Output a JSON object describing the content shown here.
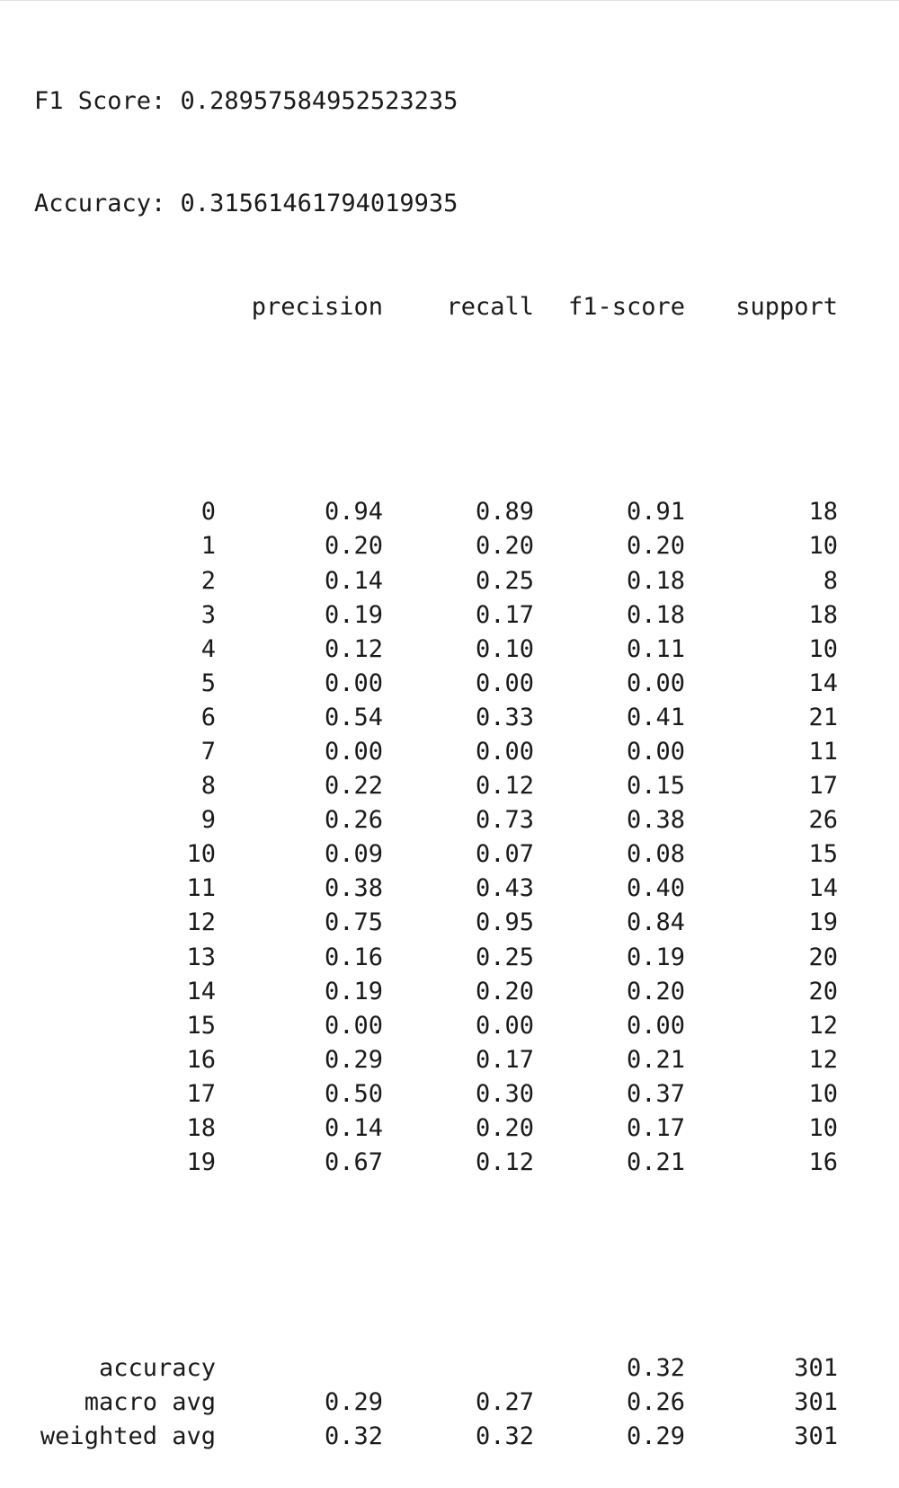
{
  "summary": {
    "f1_line": "F1 Score: 0.28957584952523235",
    "accuracy_line": "Accuracy: 0.31561461794019935"
  },
  "report": {
    "headers": [
      "",
      "precision",
      "recall",
      "f1-score",
      "support"
    ],
    "rows": [
      [
        "0",
        "0.94",
        "0.89",
        "0.91",
        "18"
      ],
      [
        "1",
        "0.20",
        "0.20",
        "0.20",
        "10"
      ],
      [
        "2",
        "0.14",
        "0.25",
        "0.18",
        "8"
      ],
      [
        "3",
        "0.19",
        "0.17",
        "0.18",
        "18"
      ],
      [
        "4",
        "0.12",
        "0.10",
        "0.11",
        "10"
      ],
      [
        "5",
        "0.00",
        "0.00",
        "0.00",
        "14"
      ],
      [
        "6",
        "0.54",
        "0.33",
        "0.41",
        "21"
      ],
      [
        "7",
        "0.00",
        "0.00",
        "0.00",
        "11"
      ],
      [
        "8",
        "0.22",
        "0.12",
        "0.15",
        "17"
      ],
      [
        "9",
        "0.26",
        "0.73",
        "0.38",
        "26"
      ],
      [
        "10",
        "0.09",
        "0.07",
        "0.08",
        "15"
      ],
      [
        "11",
        "0.38",
        "0.43",
        "0.40",
        "14"
      ],
      [
        "12",
        "0.75",
        "0.95",
        "0.84",
        "19"
      ],
      [
        "13",
        "0.16",
        "0.25",
        "0.19",
        "20"
      ],
      [
        "14",
        "0.19",
        "0.20",
        "0.20",
        "20"
      ],
      [
        "15",
        "0.00",
        "0.00",
        "0.00",
        "12"
      ],
      [
        "16",
        "0.29",
        "0.17",
        "0.21",
        "12"
      ],
      [
        "17",
        "0.50",
        "0.30",
        "0.37",
        "10"
      ],
      [
        "18",
        "0.14",
        "0.20",
        "0.17",
        "10"
      ],
      [
        "19",
        "0.67",
        "0.12",
        "0.21",
        "16"
      ]
    ],
    "summary_rows": [
      [
        "accuracy",
        "",
        "",
        "0.32",
        "301"
      ],
      [
        "macro avg",
        "0.29",
        "0.27",
        "0.26",
        "301"
      ],
      [
        "weighted avg",
        "0.32",
        "0.32",
        "0.29",
        "301"
      ]
    ]
  }
}
